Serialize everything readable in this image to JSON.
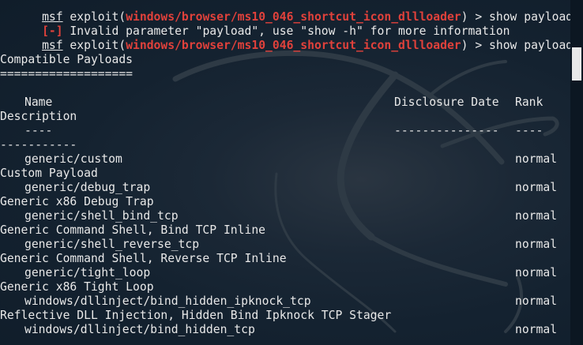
{
  "terminal": {
    "history": [
      {
        "prompt": "msf",
        "module_prefix": " exploit(",
        "module": "windows/browser/ms10_046_shortcut_icon_dllloader",
        "module_suffix": ") > ",
        "command": "show payload"
      },
      {
        "error_tag": "[-]",
        "error_text": " Invalid parameter \"payload\", use \"show -h\" for more information"
      },
      {
        "prompt": "msf",
        "module_prefix": " exploit(",
        "module": "windows/browser/ms10_046_shortcut_icon_dllloader",
        "module_suffix": ") > ",
        "command": "show payloads"
      }
    ],
    "section_title": "Compatible Payloads",
    "section_underline": "===================",
    "columns": {
      "name": "Name",
      "disclosure_date": "Disclosure Date",
      "rank": "Rank",
      "description": "Description"
    },
    "column_underlines": {
      "name": "----",
      "disclosure_date": "---------------",
      "rank": "----",
      "description": "-----------"
    },
    "payloads": [
      {
        "name": "generic/custom",
        "rank": "normal",
        "description": "Custom Payload"
      },
      {
        "name": "generic/debug_trap",
        "rank": "normal",
        "description": "Generic x86 Debug Trap"
      },
      {
        "name": "generic/shell_bind_tcp",
        "rank": "normal",
        "description": "Generic Command Shell, Bind TCP Inline"
      },
      {
        "name": "generic/shell_reverse_tcp",
        "rank": "normal",
        "description": "Generic Command Shell, Reverse TCP Inline"
      },
      {
        "name": "generic/tight_loop",
        "rank": "normal",
        "description": "Generic x86 Tight Loop"
      },
      {
        "name": "windows/dllinject/bind_hidden_ipknock_tcp",
        "rank": "normal",
        "description": "Reflective DLL Injection, Hidden Bind Ipknock TCP Stager"
      },
      {
        "name": "windows/dllinject/bind_hidden_tcp",
        "rank": "normal",
        "description": ""
      }
    ]
  },
  "background_icon": "kali-dragon-icon",
  "colors": {
    "background": "#132130",
    "text": "#e8e8e8",
    "error": "#e0413b",
    "module": "#e0413b"
  }
}
